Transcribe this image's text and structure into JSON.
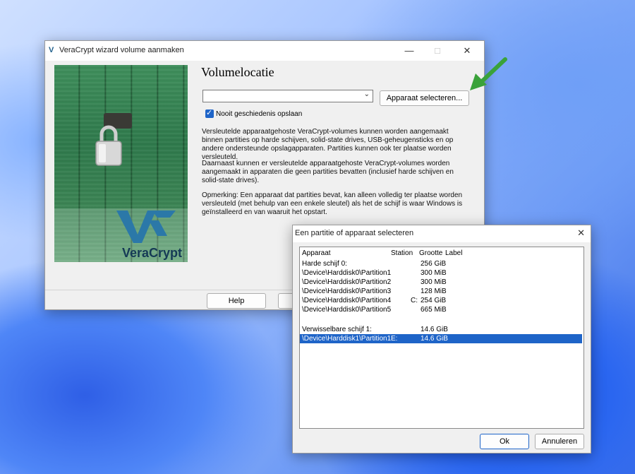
{
  "wizard": {
    "title": "VeraCrypt wizard volume aanmaken",
    "heading": "Volumelocatie",
    "location_value": "",
    "select_device_button": "Apparaat selecteren...",
    "never_save_history": "Nooit geschiedenis opslaan",
    "paragraph1": "Versleutelde apparaatgehoste VeraCrypt-volumes kunnen worden aangemaakt binnen partities op harde schijven, solid-state drives, USB-geheugensticks en op andere ondersteunde opslagapparaten. Partities kunnen ook ter plaatse worden versleuteld.",
    "paragraph2": "Daarnaast kunnen er versleutelde apparaatgehoste VeraCrypt-volumes worden aangemaakt in apparaten die geen partities bevatten (inclusief harde schijven en solid-state drives).",
    "paragraph3": "Opmerking: Een apparaat dat partities bevat, kan alleen volledig ter plaatse worden versleuteld (met behulp van een enkele sleutel) als het de schijf is waar Windows is geïnstalleerd en van waaruit het opstart.",
    "help_button": "Help",
    "logo_text": "VeraCrypt"
  },
  "dialog": {
    "title": "Een partitie of apparaat selecteren",
    "columns": {
      "device": "Apparaat",
      "station": "Station",
      "size": "Grootte",
      "label": "Label"
    },
    "rows": [
      {
        "device": "Harde schijf 0:",
        "station": "",
        "size": "256 GiB",
        "label": ""
      },
      {
        "device": "\\Device\\Harddisk0\\Partition1",
        "station": "",
        "size": "300 MiB",
        "label": ""
      },
      {
        "device": "\\Device\\Harddisk0\\Partition2",
        "station": "",
        "size": "300 MiB",
        "label": ""
      },
      {
        "device": "\\Device\\Harddisk0\\Partition3",
        "station": "",
        "size": "128 MiB",
        "label": ""
      },
      {
        "device": "\\Device\\Harddisk0\\Partition4",
        "station": "C:",
        "size": "254 GiB",
        "label": ""
      },
      {
        "device": "\\Device\\Harddisk0\\Partition5",
        "station": "",
        "size": "665 MiB",
        "label": ""
      },
      {
        "device": "",
        "station": "",
        "size": "",
        "label": ""
      },
      {
        "device": "Verwisselbare schijf 1:",
        "station": "",
        "size": "14.6 GiB",
        "label": ""
      },
      {
        "device": "\\Device\\Harddisk1\\Partition1",
        "station": "E:",
        "size": "14.6 GiB",
        "label": ""
      }
    ],
    "selected_index": 8,
    "ok_button": "Ok",
    "cancel_button": "Annuleren"
  },
  "colors": {
    "accent": "#1e64c8",
    "arrow": "#3aa23a"
  }
}
